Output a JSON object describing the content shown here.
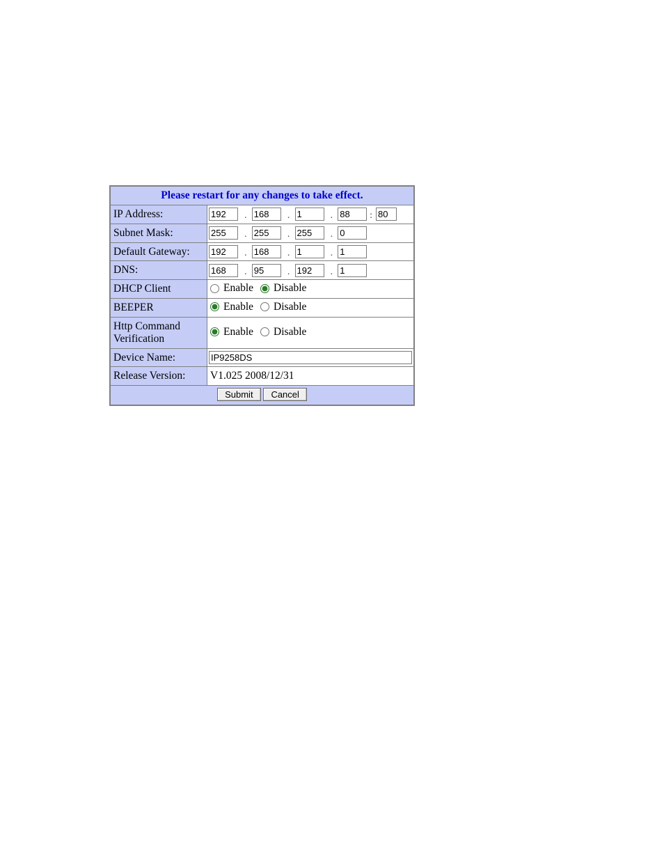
{
  "header": {
    "title": "Please restart for any changes to take effect."
  },
  "labels": {
    "ip": "IP Address:",
    "subnet": "Subnet Mask:",
    "gateway": "Default Gateway:",
    "dns": "DNS:",
    "dhcp": "DHCP Client",
    "beeper": "BEEPER",
    "httpcmd": "Http Command Verification",
    "devname": "Device Name:",
    "release": "Release Version:"
  },
  "net": {
    "ip": {
      "o1": "192",
      "o2": "168",
      "o3": "1",
      "o4": "88",
      "port": "80"
    },
    "subnet": {
      "o1": "255",
      "o2": "255",
      "o3": "255",
      "o4": "0"
    },
    "gateway": {
      "o1": "192",
      "o2": "168",
      "o3": "1",
      "o4": "1"
    },
    "dns": {
      "o1": "168",
      "o2": "95",
      "o3": "192",
      "o4": "1"
    }
  },
  "radios": {
    "enable": "Enable",
    "disable": "Disable",
    "dhcp_selected": "disable",
    "beeper_selected": "enable",
    "httpcmd_selected": "enable"
  },
  "device": {
    "name": "IP9258DS",
    "release": "V1.025 2008/12/31"
  },
  "buttons": {
    "submit": "Submit",
    "cancel": "Cancel"
  },
  "sep": {
    "dot": ".",
    "colon": ":"
  }
}
